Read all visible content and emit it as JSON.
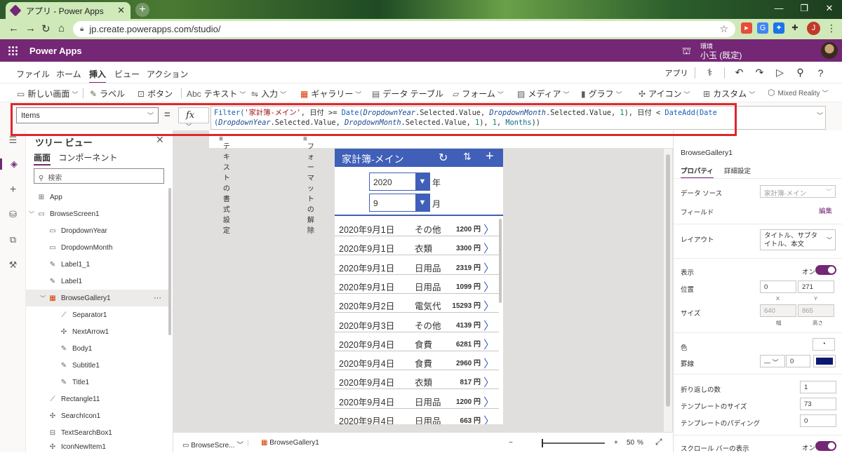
{
  "browser": {
    "tab_title": "アプリ - Power Apps",
    "url": "jp.create.powerapps.com/studio/",
    "profile_initial": "J"
  },
  "header": {
    "app_name": "Power Apps",
    "env_label": "環境",
    "env_name": "小玉 (既定)"
  },
  "menu": {
    "items": [
      "ファイル",
      "ホーム",
      "挿入",
      "ビュー",
      "アクション"
    ],
    "active": "挿入",
    "app_label": "アプリ"
  },
  "ribbon": {
    "items": [
      "新しい画面",
      "ラベル",
      "ボタン",
      "テキスト",
      "入力",
      "ギャラリー",
      "データ テーブル",
      "フォーム",
      "メディア",
      "グラフ",
      "アイコン",
      "カスタム",
      "Mixed Reality"
    ]
  },
  "formula_bar": {
    "property": "Items",
    "equals": "=",
    "fx": "fx",
    "line1": {
      "p1": "Filter(",
      "s1": "'家計簿-メイン'",
      "p2": ", 日付 >= ",
      "f1": "Date(",
      "c1": "DropdownYear",
      "p3": ".Selected.Value, ",
      "c2": "DropdownMonth",
      "p4": ".Selected.Value, ",
      "n1": "1",
      "p5": "), 日付 < ",
      "f2": "DateAdd(",
      "f3": "Date"
    },
    "line2": {
      "p1": "(",
      "c1": "DropdownYear",
      "p2": ".Selected.Value, ",
      "c2": "DropdownMonth",
      "p3": ".Selected.Value, ",
      "n1": "1",
      "p4": "), ",
      "n2": "1",
      "p5": ", ",
      "k1": "Months",
      "p6": "))"
    }
  },
  "text_tools": {
    "format_text": "テキストの書式設定",
    "remove_format": "フォーマットの解除"
  },
  "tree": {
    "title": "ツリー ビュー",
    "tab_screens": "画面",
    "tab_components": "コンポーネント",
    "search_placeholder": "検索",
    "nodes": [
      "App",
      "BrowseScreen1",
      "DropdownYear",
      "DropdownMonth",
      "Label1_1",
      "Label1",
      "BrowseGallery1",
      "Separator1",
      "NextArrow1",
      "Body1",
      "Subtitle1",
      "Title1",
      "Rectangle11",
      "SearchIcon1",
      "TextSearchBox1",
      "IconNewItem1"
    ]
  },
  "app_screen": {
    "title": "家計簿-メイン",
    "year_value": "2020",
    "year_suffix": "年",
    "month_value": "9",
    "month_suffix": "月",
    "rows": [
      {
        "date": "2020年9月1日",
        "category": "その他",
        "amount": "1200 円"
      },
      {
        "date": "2020年9月1日",
        "category": "衣類",
        "amount": "3300 円"
      },
      {
        "date": "2020年9月1日",
        "category": "日用品",
        "amount": "2319 円"
      },
      {
        "date": "2020年9月1日",
        "category": "日用品",
        "amount": "1099 円"
      },
      {
        "date": "2020年9月2日",
        "category": "電気代",
        "amount": "15293 円"
      },
      {
        "date": "2020年9月3日",
        "category": "その他",
        "amount": "4139 円"
      },
      {
        "date": "2020年9月4日",
        "category": "食費",
        "amount": "6281 円"
      },
      {
        "date": "2020年9月4日",
        "category": "食費",
        "amount": "2960 円"
      },
      {
        "date": "2020年9月4日",
        "category": "衣類",
        "amount": "817 円"
      },
      {
        "date": "2020年9月4日",
        "category": "日用品",
        "amount": "1200 円"
      },
      {
        "date": "2020年9月4日",
        "category": "日用品",
        "amount": "663 円"
      }
    ]
  },
  "status_bar": {
    "screen": "BrowseScre...",
    "control": "BrowseGallery1",
    "zoom_minus": "−",
    "zoom_plus": "+",
    "zoom_value": "50",
    "zoom_unit": "%"
  },
  "properties": {
    "control_name": "BrowseGallery1",
    "tab_properties": "プロパティ",
    "tab_advanced": "詳細設定",
    "data_source_label": "データ ソース",
    "data_source_value": "家計簿-メイン",
    "fields_label": "フィールド",
    "fields_edit": "編集",
    "layout_label": "レイアウト",
    "layout_value": "タイトル、サブタイトル、本文",
    "visible_label": "表示",
    "visible_value": "オン",
    "position_label": "位置",
    "pos_x": "0",
    "pos_y": "271",
    "x_label": "X",
    "y_label": "Y",
    "size_label": "サイズ",
    "width": "640",
    "height": "865",
    "width_label": "幅",
    "height_label": "高さ",
    "color_label": "色",
    "border_label": "罫線",
    "border_width": "0",
    "wrap_count_label": "折り返しの数",
    "wrap_count": "1",
    "template_size_label": "テンプレートのサイズ",
    "template_size": "73",
    "template_padding_label": "テンプレートのパディング",
    "template_padding": "0",
    "scrollbar_label": "スクロール バーの表示",
    "scrollbar_value": "オン"
  },
  "colors": {
    "brand_purple": "#742774",
    "app_blue": "#3f5fb8",
    "highlight_red": "#e0262b"
  }
}
